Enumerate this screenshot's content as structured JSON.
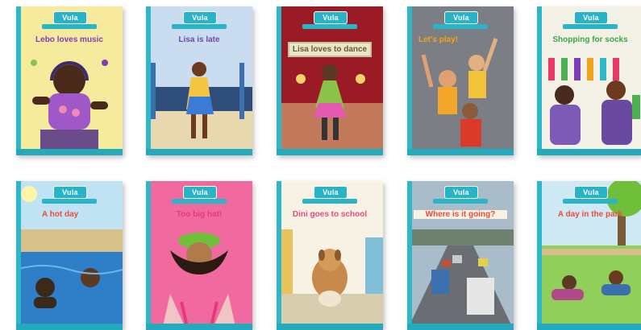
{
  "books": [
    {
      "title": "Lebo loves music",
      "title_color": "#7c3fb5",
      "bg": "#f6ea9c"
    },
    {
      "title": "Lisa is late",
      "title_color": "#6b4aa8",
      "bg": "#c9dcf0"
    },
    {
      "title": "Lisa loves to dance",
      "title_color": "#6a5a34",
      "bg": "#9a1b25"
    },
    {
      "title": "Let's play!",
      "title_color": "#f2a21b",
      "bg": "#7b7f85"
    },
    {
      "title": "Shopping for socks",
      "title_color": "#3aa84a",
      "bg": "#f3f0e6"
    },
    {
      "title": "A hot day",
      "title_color": "#ef4a3a",
      "bg": "#bfe3f3"
    },
    {
      "title": "Too big hat!",
      "title_color": "#e23a7a",
      "bg": "#f06aa0"
    },
    {
      "title": "Dini goes to school",
      "title_color": "#e64a86",
      "bg": "#f7f2e4"
    },
    {
      "title": "Where is it going?",
      "title_color": "#ef4a3a",
      "bg": "#a9bcc9"
    },
    {
      "title": "A day in the park",
      "title_color": "#ef4a3a",
      "bg": "#cfe9f4"
    }
  ],
  "series_logo": "Vula",
  "colors": {
    "spine": "#2fb7c9",
    "band": "#25a9bd"
  }
}
